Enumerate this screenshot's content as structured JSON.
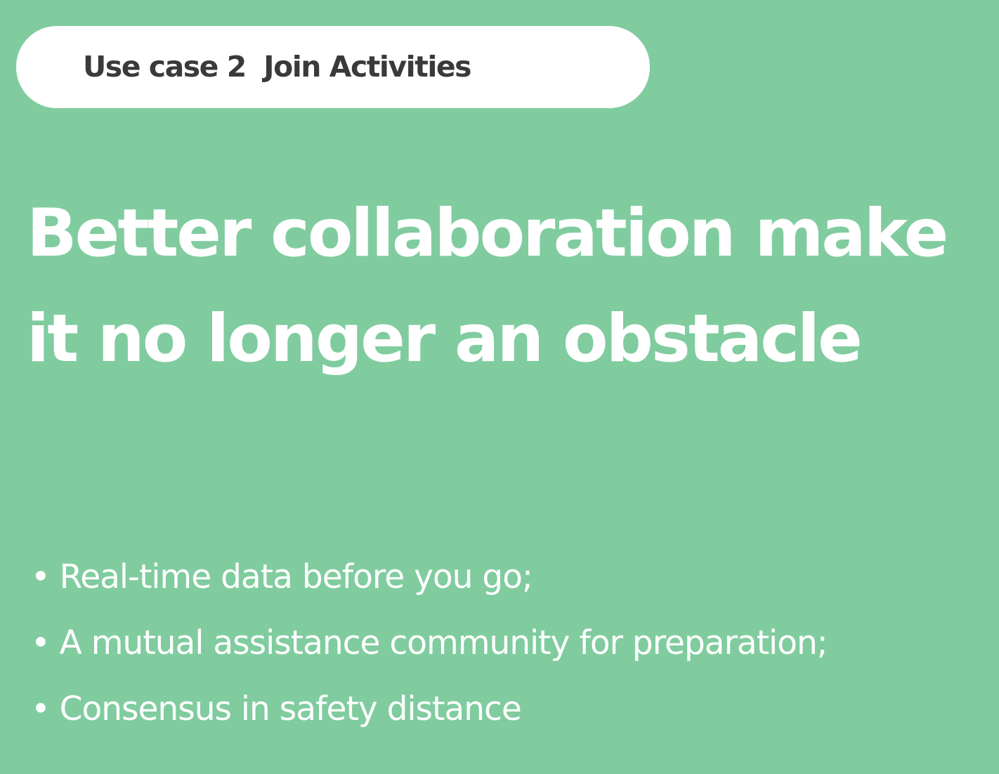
{
  "colors": {
    "background": "#80cc9f",
    "pill_background": "#ffffff",
    "pill_text": "#3a3a3a",
    "headline_text": "#ffffff",
    "bullet_text": "#ffffff"
  },
  "header": {
    "label": "Use case 2  Join Activities"
  },
  "headline": {
    "line1": "Better collaboration make",
    "line2": "it no longer an obstacle"
  },
  "bullets": [
    "• Real-time data before you go;",
    "• A mutual assistance community for preparation;",
    "• Consensus in safety distance"
  ]
}
